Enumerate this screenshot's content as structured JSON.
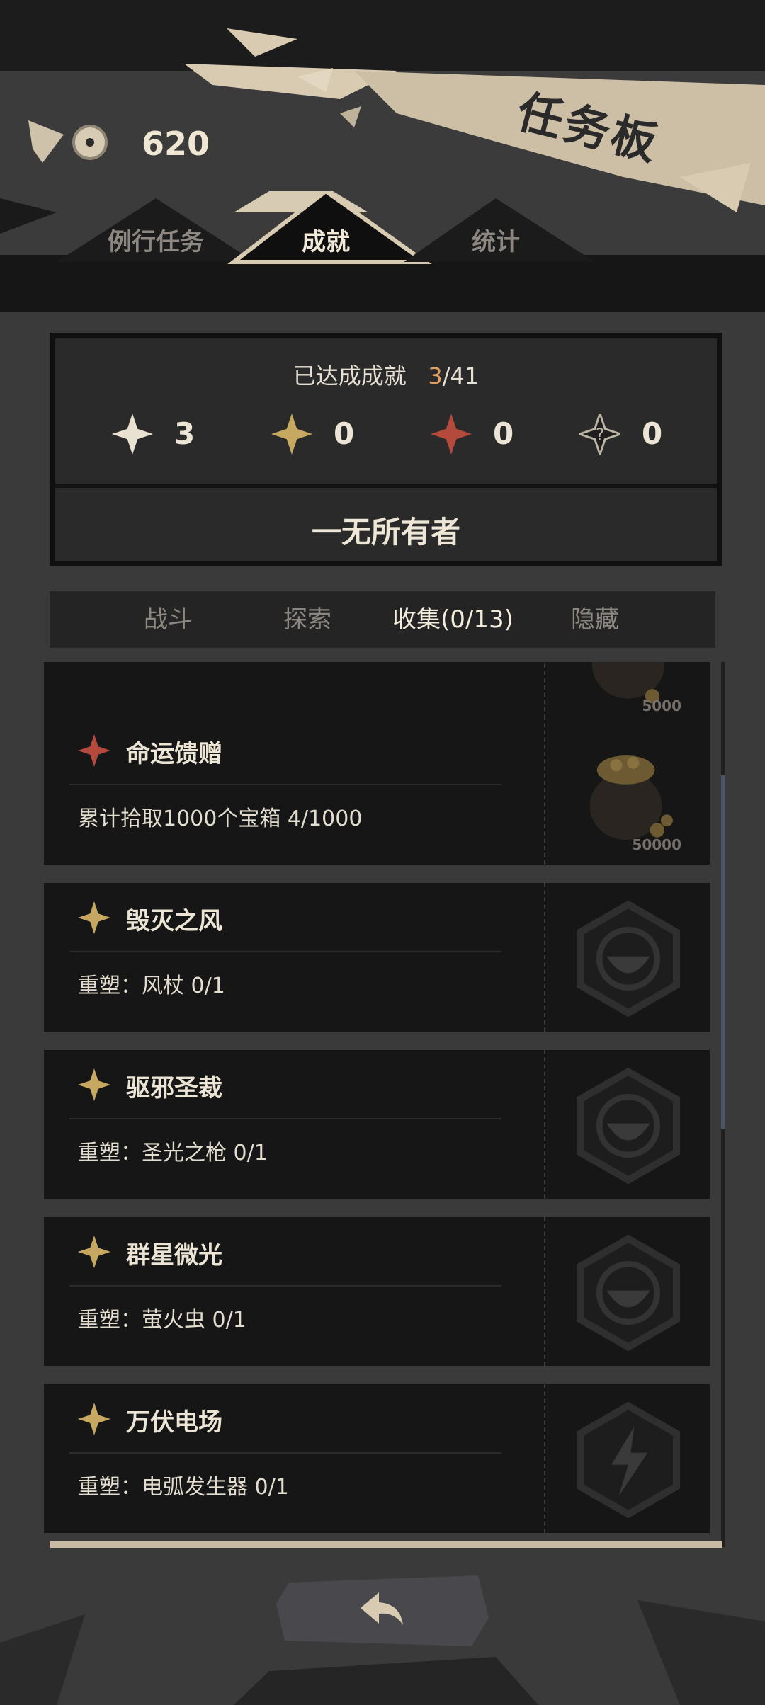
{
  "header": {
    "coin_icon": "coin-eye-icon",
    "coin_count": "620",
    "board_title": "任务板"
  },
  "tabs": [
    {
      "label": "例行任务",
      "active": false
    },
    {
      "label": "成就",
      "active": true
    },
    {
      "label": "统计",
      "active": false
    }
  ],
  "summary": {
    "title": "已达成成就",
    "current": "3",
    "total": "/41",
    "stats": [
      {
        "icon": "white-star-icon",
        "color": "#e9e2d2",
        "value": "3"
      },
      {
        "icon": "gold-star-icon",
        "color": "#c7a860",
        "value": "0"
      },
      {
        "icon": "red-star-icon",
        "color": "#b44a3c",
        "value": "0"
      },
      {
        "icon": "hidden-star-icon",
        "color": "#1e1e1e",
        "value": "0"
      }
    ],
    "rank_title": "一无所有者"
  },
  "categories": [
    {
      "label": "战斗",
      "active": false
    },
    {
      "label": "探索",
      "active": false
    },
    {
      "label": "收集(0/13)",
      "active": true
    },
    {
      "label": "隐藏",
      "active": false
    }
  ],
  "achievements": [
    {
      "title": "",
      "desc": "",
      "star": "none",
      "reward_icon": "coin-bag-icon",
      "reward_amount": "5000"
    },
    {
      "title": "命运馈赠",
      "desc": "累计拾取1000个宝箱 4/1000",
      "star": "red-star-icon",
      "reward_icon": "coin-bag-icon",
      "reward_amount": "50000"
    },
    {
      "title": "毁灭之风",
      "desc": "重塑：风杖 0/1",
      "star": "gold-star-icon",
      "reward_icon": "hex-bowl-icon",
      "reward_amount": ""
    },
    {
      "title": "驱邪圣裁",
      "desc": "重塑：圣光之枪 0/1",
      "star": "gold-star-icon",
      "reward_icon": "hex-bowl-icon",
      "reward_amount": ""
    },
    {
      "title": "群星微光",
      "desc": "重塑：萤火虫 0/1",
      "star": "gold-star-icon",
      "reward_icon": "hex-bowl-icon",
      "reward_amount": ""
    },
    {
      "title": "万伏电场",
      "desc": "重塑：电弧发生器 0/1",
      "star": "gold-star-icon",
      "reward_icon": "hex-lightning-icon",
      "reward_amount": ""
    }
  ],
  "back_button": {
    "icon": "back-arrow-icon"
  }
}
